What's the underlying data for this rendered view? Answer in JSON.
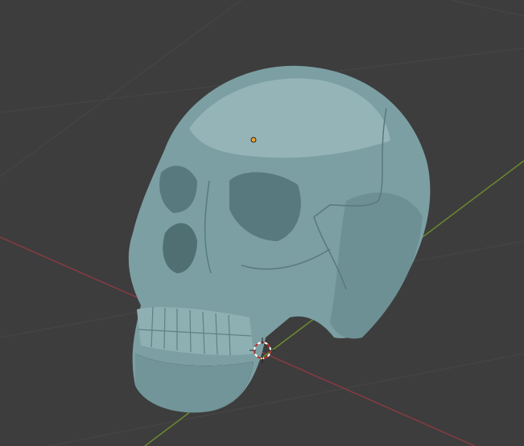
{
  "viewport": {
    "mode": "3D viewport",
    "colors": {
      "background": "#3d3d3d",
      "grid": "#474747",
      "x_axis": "#8a3a44",
      "y_axis": "#6a8a2e",
      "mesh": "#7c9fa3",
      "mesh_shadow": "#587a7e",
      "mesh_highlight": "#a4c2c5",
      "origin": "#f0a030",
      "cursor_red": "#c03030",
      "cursor_white": "#ffffff"
    },
    "icons": [
      "object-origin-icon",
      "3d-cursor-icon"
    ]
  }
}
